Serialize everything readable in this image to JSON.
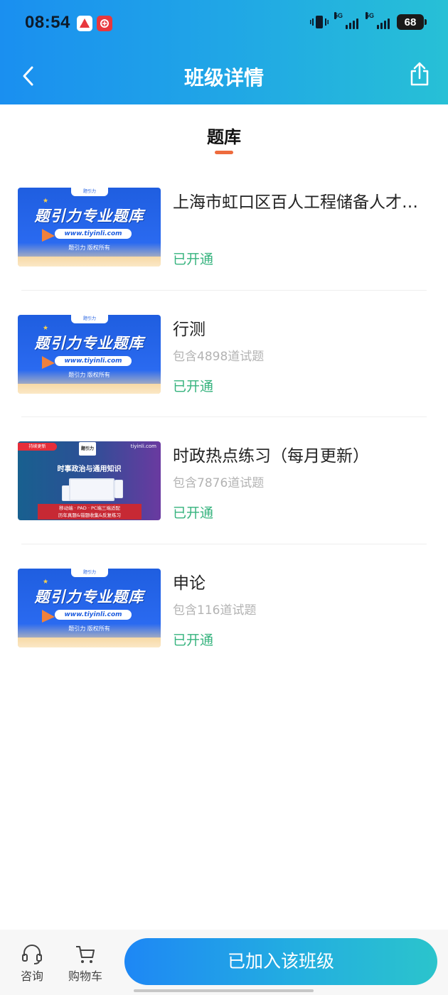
{
  "status_bar": {
    "time": "08:54",
    "network_1": "5G",
    "network_2": "5G",
    "battery": "68"
  },
  "header": {
    "title": "班级详情"
  },
  "tab": {
    "label": "题库",
    "accent_color": "#ee6b3d"
  },
  "thumbnail_blue": {
    "brand_small": "题引力",
    "headline": "题引力专业题库",
    "url": "www.tiyinli.com",
    "copyright": "题引力 版权所有"
  },
  "thumbnail_purple": {
    "badge": "持续更新",
    "logo": "题引力",
    "domain": "tiyinli.com",
    "title": "时事政治与通用知识",
    "banner_line1": "移动端 · PAD · PC端三端适配",
    "banner_line2": "历年真题&错题收集&反复练习"
  },
  "banks": [
    {
      "title": "上海市虹口区百人工程储备人才题库",
      "count": "",
      "status": "已开通",
      "thumb": "blue"
    },
    {
      "title": "行测",
      "count": "包含4898道试题",
      "status": "已开通",
      "thumb": "blue"
    },
    {
      "title": "时政热点练习（每月更新）",
      "count": "包含7876道试题",
      "status": "已开通",
      "thumb": "purple"
    },
    {
      "title": "申论",
      "count": "包含116道试题",
      "status": "已开通",
      "thumb": "blue"
    }
  ],
  "bottom_bar": {
    "consult_label": "咨询",
    "cart_label": "购物车",
    "joined_button": "已加入该班级"
  },
  "colors": {
    "status_open": "#36b37e",
    "header_gradient_start": "#1a8ff0",
    "header_gradient_end": "#27c0d6"
  }
}
